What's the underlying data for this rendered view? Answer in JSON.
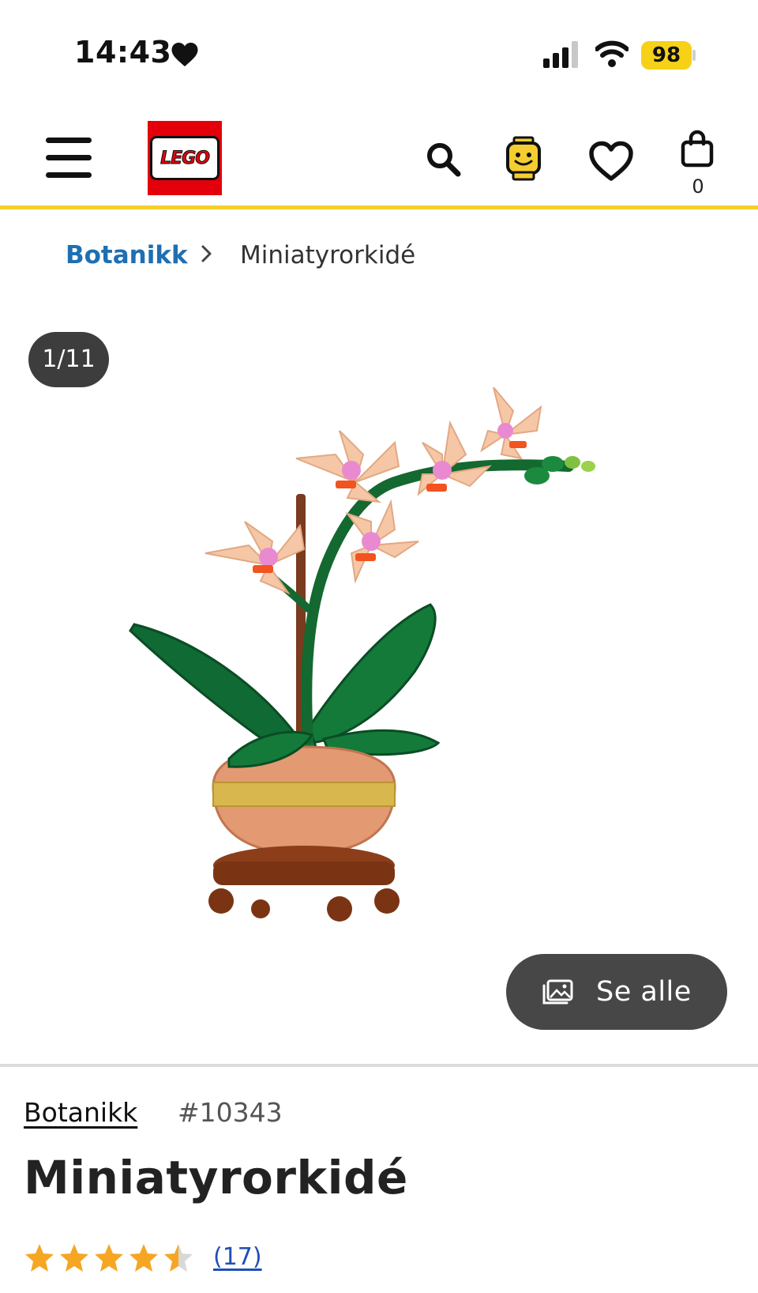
{
  "status_bar": {
    "time": "14:43",
    "battery": "98"
  },
  "header": {
    "logo_text": "LEGO",
    "bag_count": "0"
  },
  "breadcrumb": {
    "parent": "Botanikk",
    "current": "Miniatyrorkidé"
  },
  "gallery": {
    "counter": "1/11",
    "see_all_label": "Se alle"
  },
  "product": {
    "theme": "Botanikk",
    "item_number": "#10343",
    "title": "Miniatyrorkidé",
    "rating": 4.5,
    "rating_max": 5,
    "review_count": "(17)"
  },
  "colors": {
    "accent_yellow": "#f5cd2f",
    "lego_red": "#e3000b",
    "link_blue": "#1f6fb2",
    "star_orange": "#f5a623"
  }
}
